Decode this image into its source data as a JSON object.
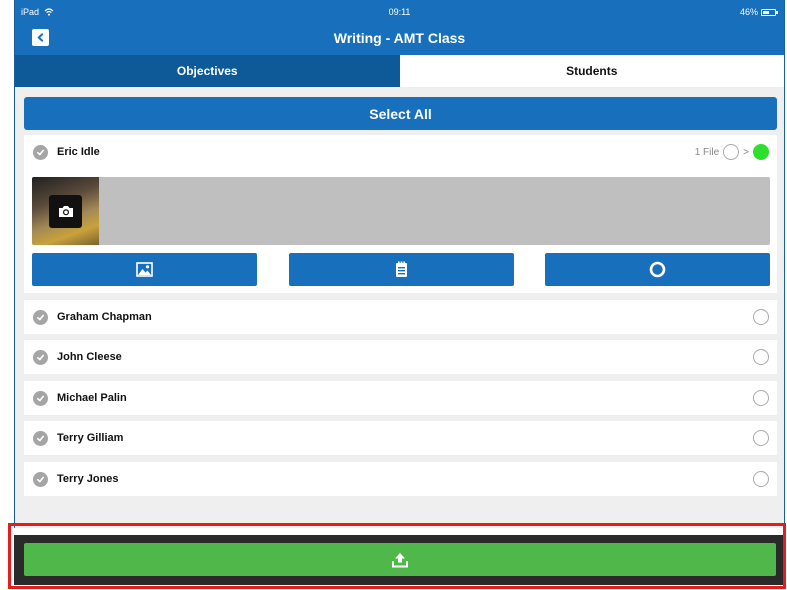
{
  "status_bar": {
    "device": "iPad",
    "time": "09:11",
    "battery": "46%"
  },
  "navbar": {
    "title": "Writing - AMT Class"
  },
  "tabs": [
    {
      "label": "Objectives",
      "selected": false
    },
    {
      "label": "Students",
      "selected": true
    }
  ],
  "select_all_label": "Select All",
  "expanded_student": {
    "name": "Eric Idle",
    "file_count": "1 File",
    "separator": ">",
    "status_color": "#2ce02c"
  },
  "action_buttons": [
    {
      "icon": "image-icon"
    },
    {
      "icon": "notepad-icon"
    },
    {
      "icon": "record-circle-icon"
    }
  ],
  "students": [
    {
      "name": "Graham Chapman"
    },
    {
      "name": "John Cleese"
    },
    {
      "name": "Michael Palin"
    },
    {
      "name": "Terry Gilliam"
    },
    {
      "name": "Terry Jones"
    }
  ],
  "footer": {
    "upload_icon": "upload-icon"
  },
  "colors": {
    "primary": "#1870bd",
    "tab_active": "#0e5a98",
    "upload": "#50b84a",
    "highlight": "#e31c1c"
  }
}
